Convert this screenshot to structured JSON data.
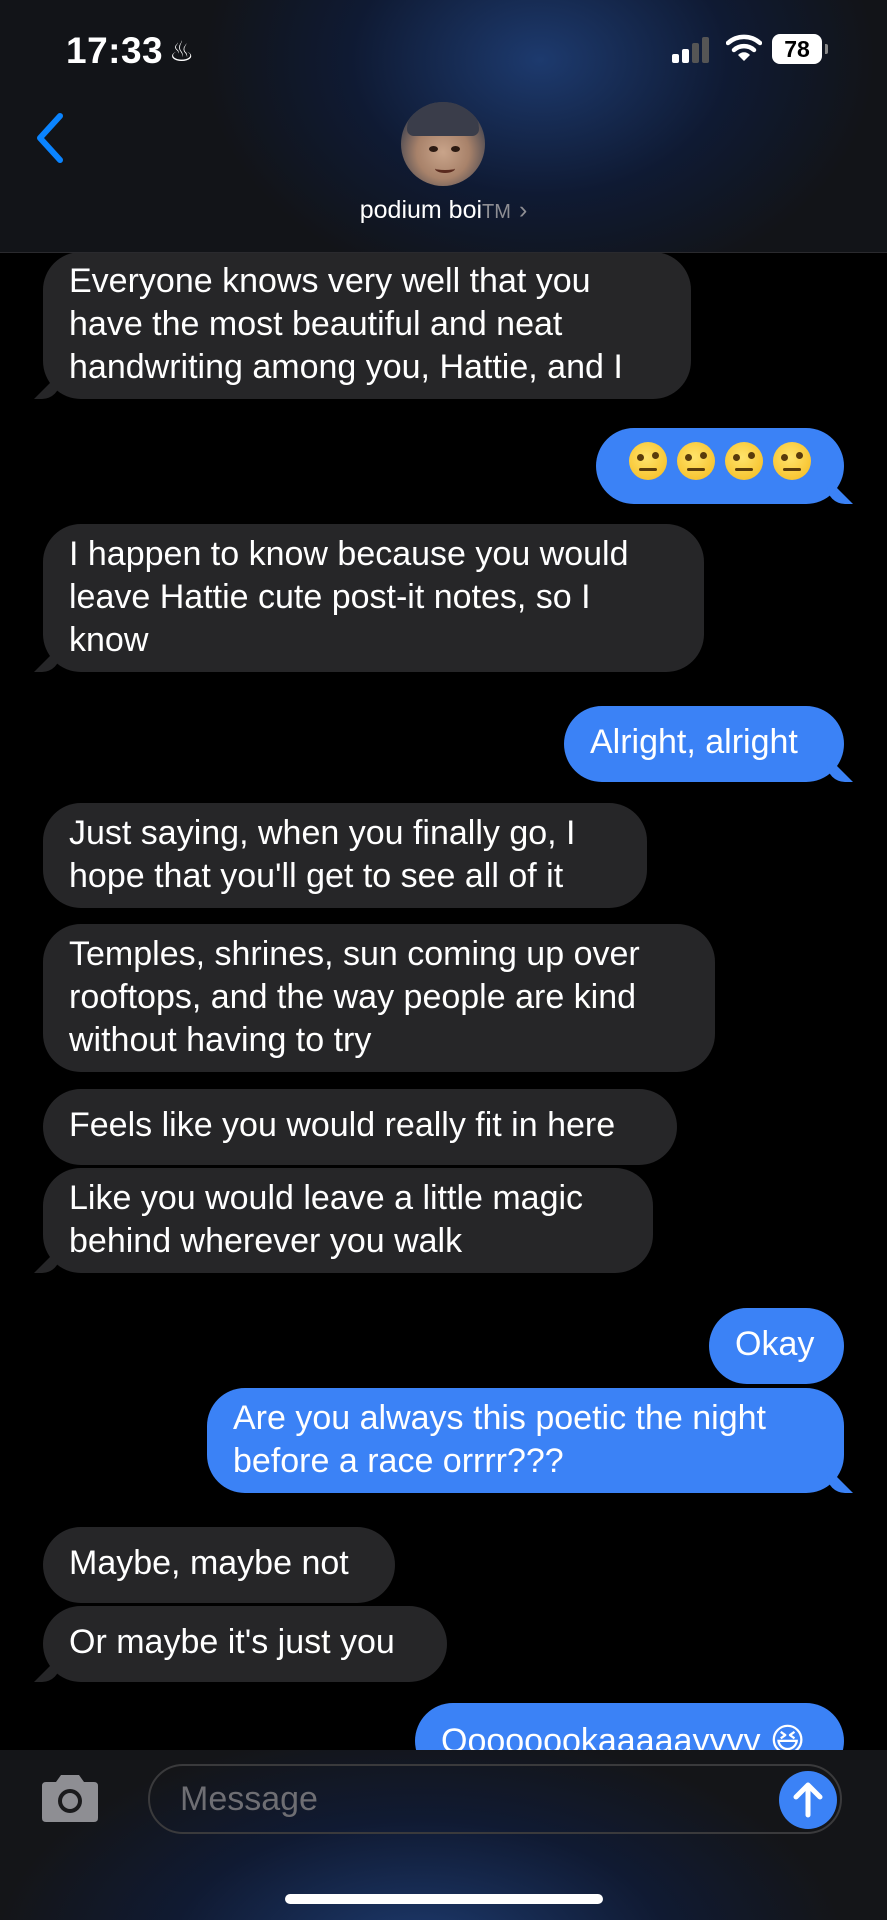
{
  "status_bar": {
    "time": "17:33",
    "battery": "78"
  },
  "header": {
    "contact_name": "podium boi",
    "trademark": "TM",
    "chevron": "›"
  },
  "messages": [
    {
      "side": "in",
      "text": "Everyone knows very well that you have the most beautiful and neat handwriting among you, Hattie, and I"
    },
    {
      "side": "out",
      "emoji": "face-with-raised-eyebrow",
      "count": 4
    },
    {
      "side": "in",
      "text": "I happen to know because you would leave Hattie cute post-it notes, so I know"
    },
    {
      "side": "out",
      "text": "Alright, alright"
    },
    {
      "side": "in",
      "text": "Just saying, when you finally go, I hope that you'll get to see all of it"
    },
    {
      "side": "in",
      "text": "Temples, shrines, sun coming up over rooftops, and the way people are kind without having to try"
    },
    {
      "side": "in",
      "text": "Feels like you would really fit in here"
    },
    {
      "side": "in",
      "text": "Like you would leave a little magic behind wherever you walk"
    },
    {
      "side": "out",
      "text": "Okay"
    },
    {
      "side": "out",
      "text": "Are you always this poetic the night before a race orrrr???"
    },
    {
      "side": "in",
      "text": "Maybe, maybe not"
    },
    {
      "side": "in",
      "text": "Or maybe it's just you"
    },
    {
      "side": "out",
      "text": "Oooooookaaaaayyyy 😆"
    }
  ],
  "composer": {
    "placeholder": "Message"
  },
  "colors": {
    "outgoing_bubble": "#3b82f6",
    "incoming_bubble": "#262628",
    "accent": "#0a84ff"
  },
  "icons": {
    "back": "chevron-left-icon",
    "camera": "camera-icon",
    "send": "arrow-up-icon",
    "flame": "flame-icon"
  }
}
